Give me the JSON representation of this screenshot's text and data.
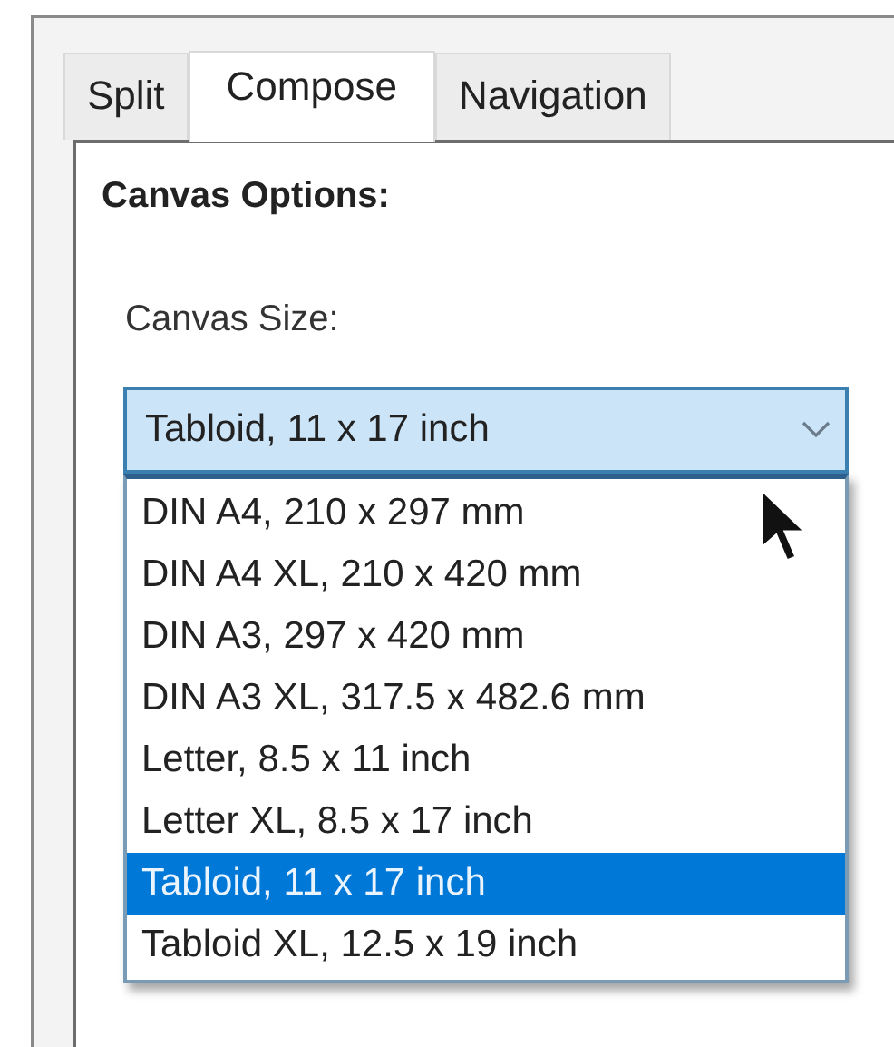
{
  "tabs": [
    {
      "label": "Split",
      "selected": false
    },
    {
      "label": "Compose",
      "selected": true
    },
    {
      "label": "Navigation",
      "selected": false
    }
  ],
  "panel": {
    "title": "Canvas Options:",
    "field_label": "Canvas Size:",
    "dropdown": {
      "value": "Tabloid, 11 x 17 inch",
      "expanded": true,
      "options": [
        {
          "label": "DIN A4, 210 x 297 mm",
          "selected": false
        },
        {
          "label": "DIN A4 XL, 210 x 420 mm",
          "selected": false
        },
        {
          "label": "DIN A3, 297 x 420 mm",
          "selected": false
        },
        {
          "label": "DIN A3 XL, 317.5 x 482.6 mm",
          "selected": false
        },
        {
          "label": "Letter, 8.5 x 11 inch",
          "selected": false
        },
        {
          "label": "Letter XL, 8.5 x 17 inch",
          "selected": false
        },
        {
          "label": "Tabloid, 11 x 17 inch",
          "selected": true
        },
        {
          "label": "Tabloid XL, 12.5 x 19 inch",
          "selected": false
        }
      ]
    }
  }
}
